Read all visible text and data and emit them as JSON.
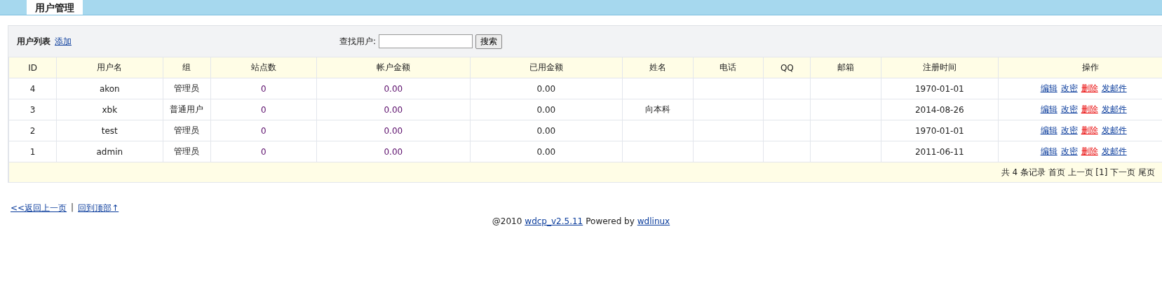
{
  "tab": {
    "label": "用户管理"
  },
  "toolbar": {
    "title": "用户列表",
    "add_link": "添加",
    "search_label": "查找用户:",
    "search_button": "搜索"
  },
  "table": {
    "columns": [
      "ID",
      "用户名",
      "组",
      "站点数",
      "帐户金额",
      "已用金额",
      "姓名",
      "电话",
      "QQ",
      "邮箱",
      "注册时间",
      "操作"
    ],
    "rows": [
      {
        "id": "4",
        "username": "akon",
        "group": "管理员",
        "sites": "0",
        "balance": "0.00",
        "used": "0.00",
        "name": "",
        "phone": "",
        "qq": "",
        "email": "",
        "registered": "1970-01-01",
        "actions": [
          {
            "label": "编辑",
            "kind": "link"
          },
          {
            "label": "改密",
            "kind": "link"
          },
          {
            "label": "删除",
            "kind": "danger"
          },
          {
            "label": "发邮件",
            "kind": "link"
          }
        ]
      },
      {
        "id": "3",
        "username": "xbk",
        "group": "普通用户",
        "sites": "0",
        "balance": "0.00",
        "used": "0.00",
        "name": "向本科",
        "phone": "",
        "qq": "",
        "email": "",
        "registered": "2014-08-26",
        "actions": [
          {
            "label": "编辑",
            "kind": "link"
          },
          {
            "label": "改密",
            "kind": "link"
          },
          {
            "label": "删除",
            "kind": "danger"
          },
          {
            "label": "发邮件",
            "kind": "link"
          }
        ]
      },
      {
        "id": "2",
        "username": "test",
        "group": "管理员",
        "sites": "0",
        "balance": "0.00",
        "used": "0.00",
        "name": "",
        "phone": "",
        "qq": "",
        "email": "",
        "registered": "1970-01-01",
        "actions": [
          {
            "label": "编辑",
            "kind": "link"
          },
          {
            "label": "改密",
            "kind": "link"
          },
          {
            "label": "删除",
            "kind": "danger"
          },
          {
            "label": "发邮件",
            "kind": "link"
          }
        ]
      },
      {
        "id": "1",
        "username": "admin",
        "group": "管理员",
        "sites": "0",
        "balance": "0.00",
        "used": "0.00",
        "name": "",
        "phone": "",
        "qq": "",
        "email": "",
        "registered": "2011-06-11",
        "actions": [
          {
            "label": "编辑",
            "kind": "link"
          },
          {
            "label": "改密",
            "kind": "link"
          },
          {
            "label": "删除",
            "kind": "danger"
          },
          {
            "label": "发邮件",
            "kind": "link"
          }
        ]
      }
    ],
    "pager": "共 4 条记录 首页 上一页 [1] 下一页 尾页"
  },
  "back_links": [
    {
      "label": "<<返回上一页"
    },
    {
      "label": "回到顶部↑"
    }
  ],
  "back_separator": "|",
  "footer": {
    "prefix": "@2010",
    "product_link": "wdcp_v2.5.11",
    "middle": "Powered by",
    "vendor_link": "wdlinux"
  }
}
